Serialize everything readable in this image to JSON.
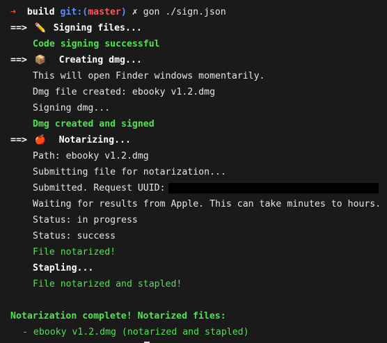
{
  "prompt": {
    "arrow": "➜",
    "dir": "build",
    "git_prefix": "git:(",
    "branch": "master",
    "git_suffix": ")",
    "dirty_mark": "✗",
    "command": "gon ./sign.json"
  },
  "steps": {
    "signing": {
      "marker": "==>",
      "emoji": "✏️",
      "title": "Signing files...",
      "result": "Code signing successful"
    },
    "dmg": {
      "marker": "==>",
      "emoji": "📦",
      "title": "Creating dmg...",
      "lines": [
        "This will open Finder windows momentarily.",
        "Dmg file created: ebooky v1.2.dmg",
        "Signing dmg..."
      ],
      "result": "Dmg created and signed"
    },
    "notarize": {
      "marker": "==>",
      "emoji": "🍎",
      "title": "Notarizing...",
      "lines": [
        "Path: ebooky v1.2.dmg",
        "Submitting file for notarization...",
        "Submitted. Request UUID:",
        "Waiting for results from Apple. This can take minutes to hours.",
        "Status: in progress",
        "Status: success"
      ],
      "notarized": "File notarized!",
      "stapling": "Stapling...",
      "stapled": "File notarized and stapled!"
    }
  },
  "summary": {
    "heading": "Notarization complete! Notarized files:",
    "files": [
      "- ebooky v1.2.dmg (notarized and stapled)"
    ]
  },
  "colors": {
    "background": "#1a1a1a",
    "text": "#e6e6e6",
    "success": "#4fe34f",
    "prompt_arrow": "#e84f3c",
    "branch": "#ff5555",
    "git": "#5d8cff"
  }
}
